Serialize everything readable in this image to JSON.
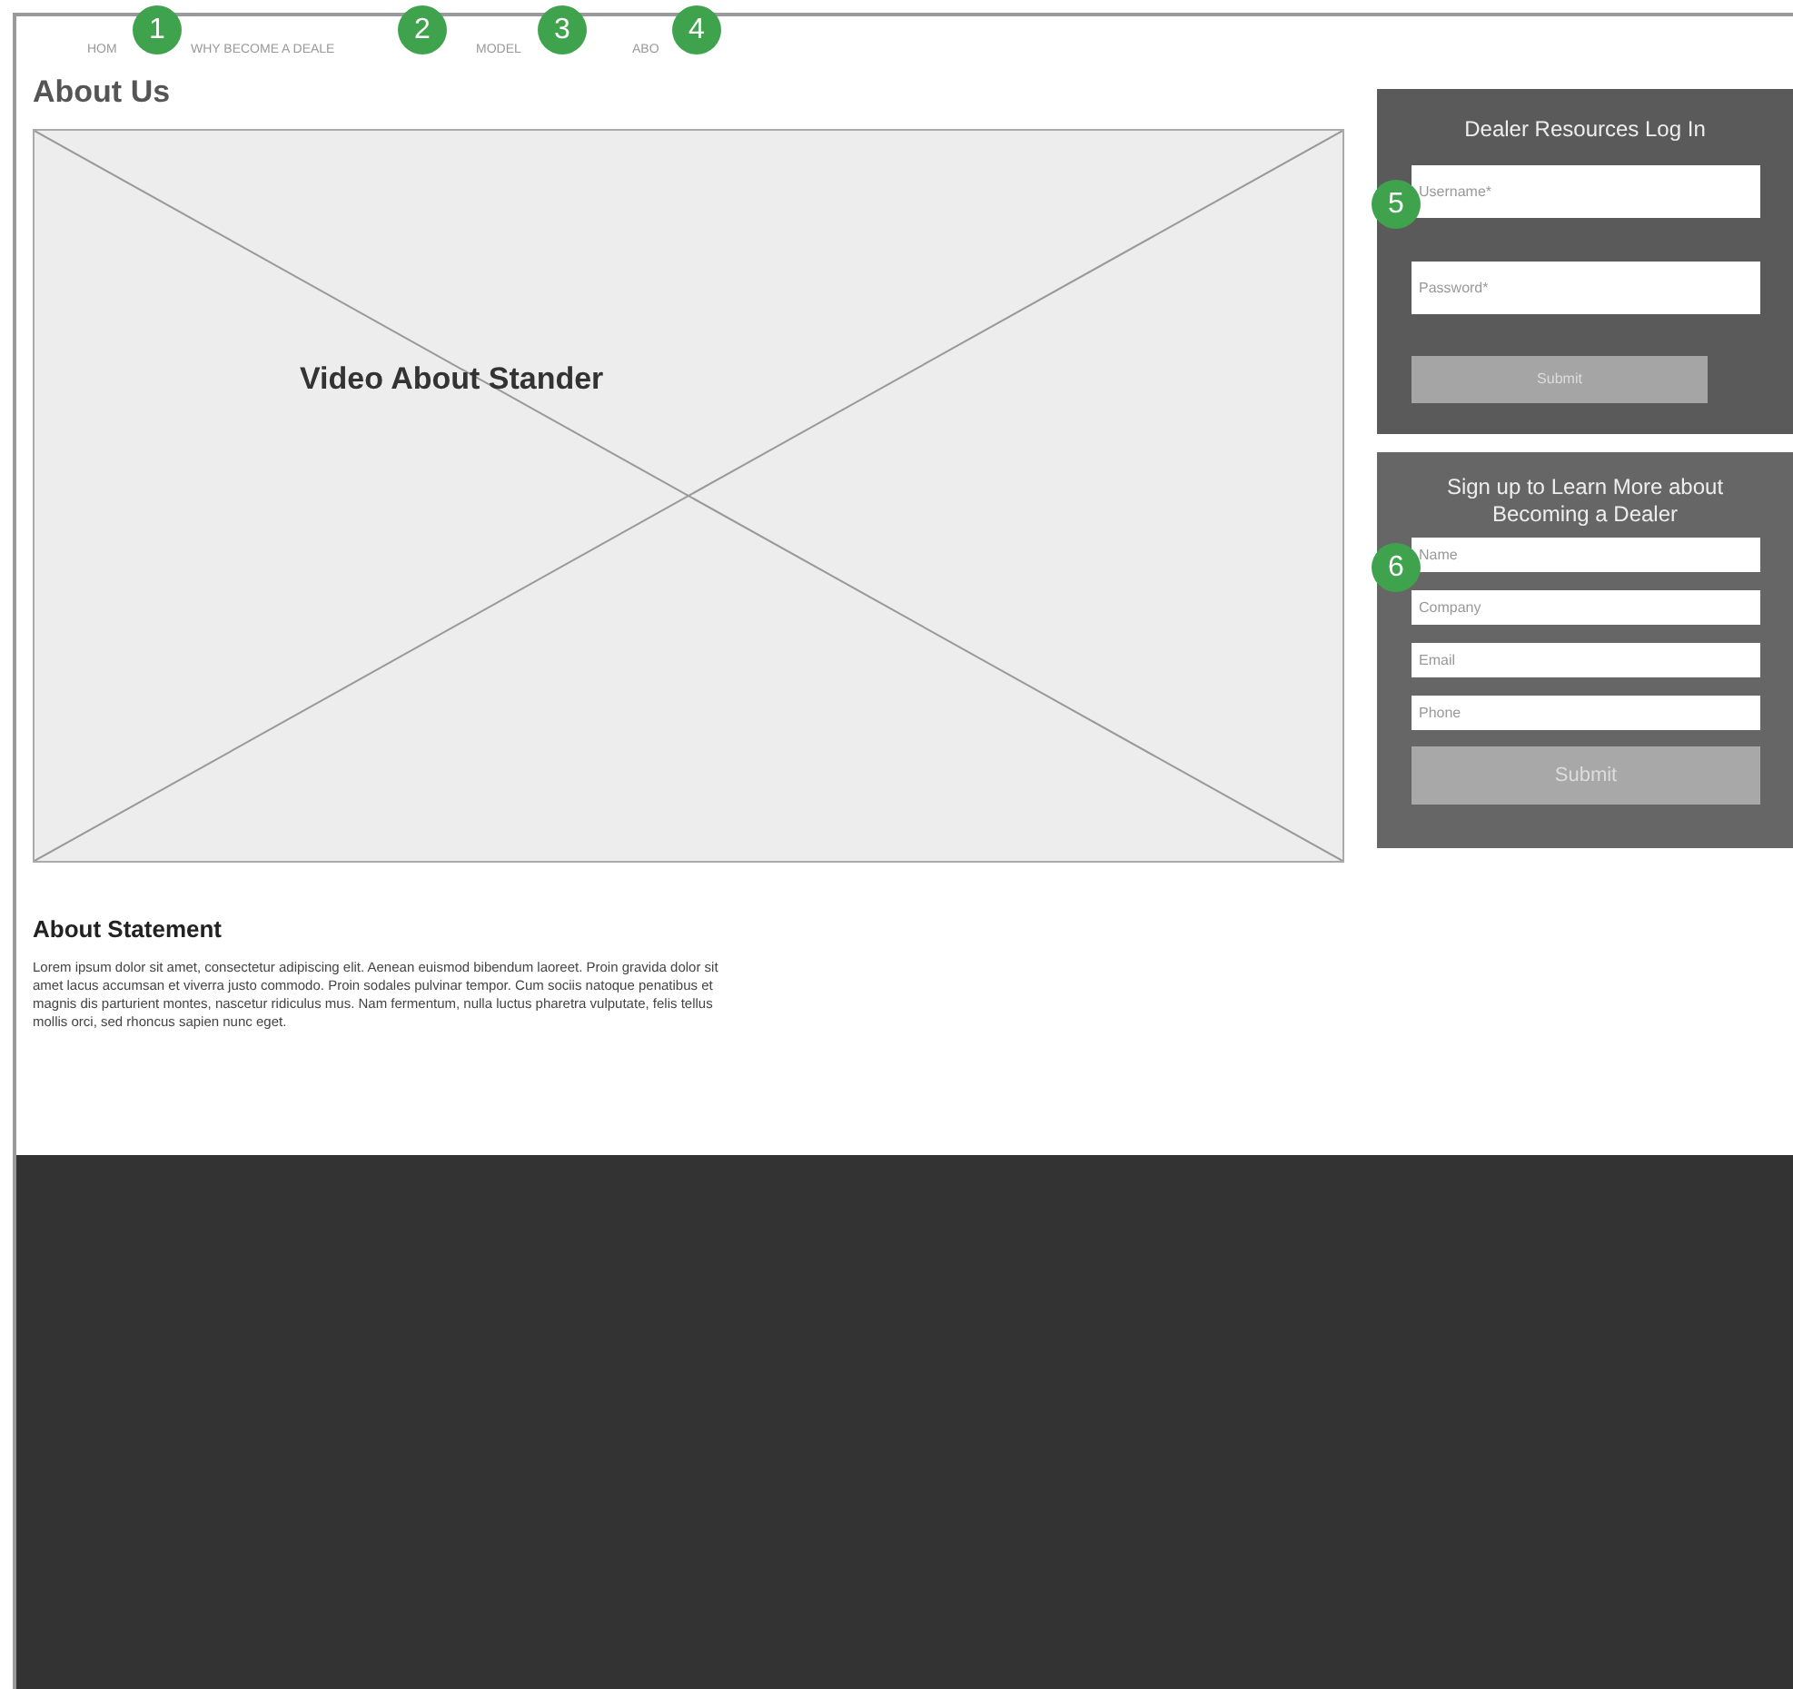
{
  "nav": [
    {
      "label": "HOM"
    },
    {
      "label": "WHY BECOME A DEALE"
    },
    {
      "label": "MODEL"
    },
    {
      "label": "ABO"
    }
  ],
  "annotations": [
    "1",
    "2",
    "3",
    "4",
    "5",
    "6"
  ],
  "page_title": "About Us",
  "video": {
    "title": "Video About Stander"
  },
  "statement": {
    "heading": "About Statement",
    "body": "Lorem ipsum dolor sit amet, consectetur adipiscing elit. Aenean euismod bibendum laoreet. Proin gravida dolor sit amet lacus accumsan et viverra justo commodo. Proin sodales pulvinar tempor. Cum sociis natoque penatibus et magnis dis parturient montes, nascetur ridiculus mus. Nam fermentum, nulla luctus pharetra vulputate, felis tellus mollis orci, sed rhoncus sapien nunc eget."
  },
  "login": {
    "title": "Dealer Resources Log In",
    "fields": [
      {
        "placeholder": "Username*"
      },
      {
        "placeholder": "Password*"
      }
    ],
    "button": "Submit"
  },
  "signup": {
    "title": "Sign up to Learn More about Becoming a Dealer",
    "fields": [
      {
        "placeholder": "Name"
      },
      {
        "placeholder": "Company"
      },
      {
        "placeholder": "Email"
      },
      {
        "placeholder": "Phone"
      }
    ],
    "button": "Submit"
  }
}
